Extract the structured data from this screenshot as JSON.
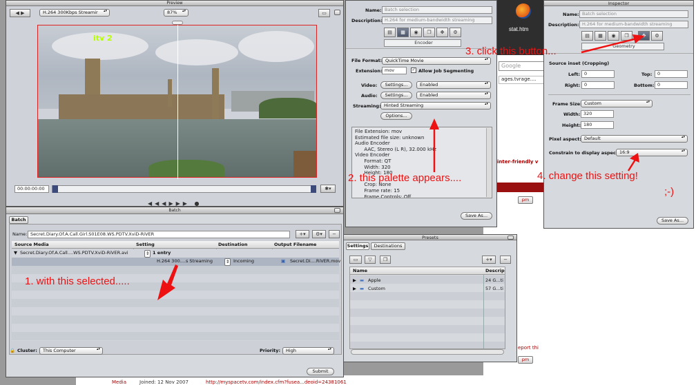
{
  "preview": {
    "title": "Preview",
    "setting_popup": "H.264 300Kbps Streamir",
    "zoom_popup": "87%",
    "timecode": "00:00:00:00",
    "logo_text": "itv 2"
  },
  "inspector_left": {
    "name_label": "Name:",
    "name_value": "Batch selection",
    "description_label": "Description:",
    "description_value": "H.264 for medium-bandwidth streaming",
    "tab_label": "Encoder",
    "file_format_label": "File Format:",
    "file_format_value": "QuickTime Movie",
    "extension_label": "Extension:",
    "extension_value": "mov",
    "allow_segmenting_label": "Allow Job Segmenting",
    "video_label": "Video:",
    "audio_label": "Audio:",
    "settings_button": "Settings...",
    "enabled_value": "Enabled",
    "streaming_label": "Streaming:",
    "streaming_value": "Hinted Streaming",
    "options_button": "Options...",
    "summary_lines": [
      "File Extension: mov",
      "Estimated file size: unknown",
      "Audio Encoder",
      "      AAC, Stereo (L R), 32.000 kHz",
      "Video Encoder",
      "      Format: QT",
      "      Width: 320",
      "      Height: 180",
      "",
      "      Crop: None",
      "      Frame rate: 15",
      "      Frame Controls: Off"
    ],
    "save_as_button": "Save As..."
  },
  "inspector_right": {
    "title": "Inspector",
    "name_label": "Name:",
    "name_value": "Batch selection",
    "description_label": "Description:",
    "description_value": "H.264 for medium-bandwidth streaming",
    "tab_label": "Geometry",
    "source_inset_label": "Source inset (Cropping)",
    "left_label": "Left:",
    "left_value": "0",
    "top_label": "Top:",
    "top_value": "0",
    "right_label": "Right:",
    "right_value": "0",
    "bottom_label": "Bottom:",
    "bottom_value": "0",
    "frame_size_label": "Frame Size:",
    "frame_size_value": "Custom",
    "width_label": "Width:",
    "width_value": "320",
    "height_label": "Height:",
    "height_value": "180",
    "pixel_aspect_label": "Pixel aspect:",
    "pixel_aspect_value": "Default",
    "constrain_label": "Constrain to display aspect:",
    "constrain_value": "16:9",
    "save_as_button": "Save As..."
  },
  "batch": {
    "title": "Batch",
    "tab_label": "Batch",
    "name_label": "Name:",
    "name_value": "Secret.Diary.Of.A.Call.Girl.S01E08.WS.PDTV.XviD-RiVER",
    "col_source": "Source Media",
    "col_setting": "Setting",
    "col_destination": "Destination",
    "col_output": "Output Filename",
    "row1_source": "Secret.Diary.Of.A.Call....WS.PDTV.XviD-RiVER.avi",
    "row1_setting": "1 entry",
    "row2_setting": "H.264 300....s Streaming",
    "row2_destination": "Incoming",
    "row2_output": "Secret.Di....RiVER.mov",
    "cluster_label": "Cluster:",
    "cluster_value": "This Computer",
    "priority_label": "Priority:",
    "priority_value": "High",
    "submit_button": "Submit"
  },
  "presets": {
    "title": "Presets",
    "tab_settings": "Settings",
    "tab_destinations": "Destinations",
    "col_name": "Name",
    "col_description": "Descrip",
    "items": [
      {
        "name": "Apple",
        "desc": "24 G...ti"
      },
      {
        "name": "Custom",
        "desc": "57 G...ti"
      }
    ]
  },
  "browser": {
    "file_label": "stat.htm",
    "search_placeholder": "Google",
    "url_fragment": "ages.tvrage....",
    "printer_text": "inter-friendly v",
    "pm_label": "pm",
    "report_text": "eport thi",
    "joined_text": "Joined: 12 Nov 2007",
    "media_text": "Media",
    "link_text": "http://myspacetv.com/index.cfm?fusea...deoid=24381061"
  },
  "annotations": {
    "a1": "1. with this selected.....",
    "a2": "2. this palette appears....",
    "a3": "3. click this button...",
    "a4": "4. change this setting!",
    "a5": ";-)"
  },
  "colors": {
    "annotation_red": "#ee1111",
    "window_bg": "#d6d9de",
    "selection_dark": "#4d566a"
  }
}
